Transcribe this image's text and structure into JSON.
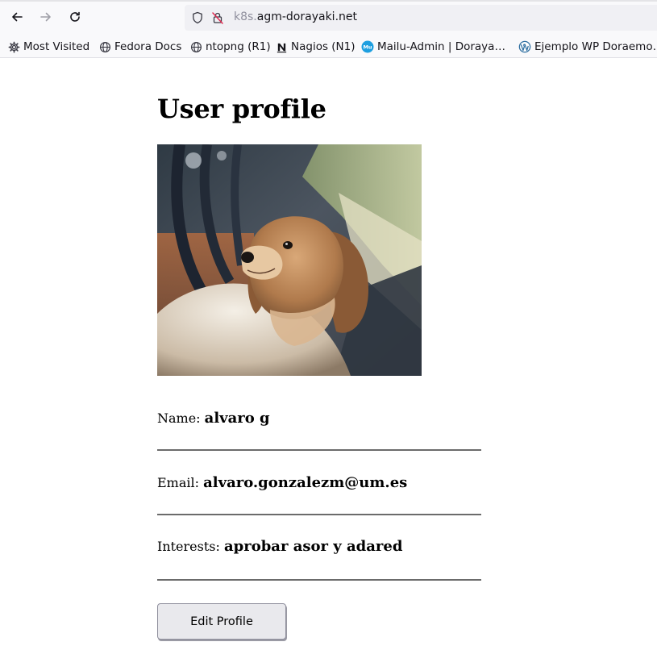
{
  "browser": {
    "url_subdomain": "k8s.",
    "url_domain": "agm-dorayaki.net",
    "bookmarks": [
      {
        "label": "Most Visited",
        "icon": "gear-icon"
      },
      {
        "label": "Fedora Docs",
        "icon": "globe-icon"
      },
      {
        "label": "ntopng (R1)",
        "icon": "globe-icon"
      },
      {
        "label": "Nagios (N1)",
        "icon": "nagios-icon"
      },
      {
        "label": "Mailu-Admin | Doraya…",
        "icon": "mailu-icon"
      },
      {
        "label": "Ejemplo WP Doraemo…",
        "icon": "wordpress-icon"
      }
    ]
  },
  "profile": {
    "title": "User profile",
    "name_label": "Name: ",
    "name_value": "alvaro g",
    "email_label": "Email: ",
    "email_value": "alvaro.gonzalezm@um.es",
    "interests_label": "Interests: ",
    "interests_value": "aprobar asor y adared",
    "edit_button": "Edit Profile"
  }
}
